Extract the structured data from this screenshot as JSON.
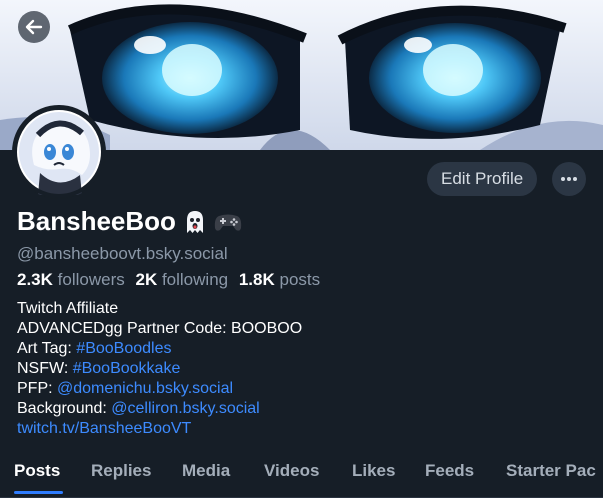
{
  "header": {
    "back_icon": "arrow-left-icon"
  },
  "profile": {
    "display_name": "BansheeBoo",
    "name_emoji": [
      "ghost-emoji",
      "gamepad-emoji"
    ],
    "handle": "@bansheeboovt.bsky.social",
    "edit_button_label": "Edit Profile",
    "more_icon": "ellipsis-icon"
  },
  "stats": {
    "followers_count": "2.3K",
    "followers_label": "followers",
    "following_count": "2K",
    "following_label": "following",
    "posts_count": "1.8K",
    "posts_label": "posts"
  },
  "bio": {
    "line1": "Twitch Affiliate",
    "line2": "ADVANCEDgg Partner Code: BOOBOO",
    "art_tag_label": "Art Tag: ",
    "art_tag_link": "#BooBoodles",
    "nsfw_label": "NSFW: ",
    "nsfw_link": "#BooBookkake",
    "pfp_label": "PFP: ",
    "pfp_link": "@domenichu.bsky.social",
    "background_label": "Background: ",
    "background_link": "@celliron.bsky.social",
    "twitch_link": "twitch.tv/BansheeBooVT"
  },
  "tabs": [
    "Posts",
    "Replies",
    "Media",
    "Videos",
    "Likes",
    "Feeds",
    "Starter Pac"
  ],
  "active_tab": "Posts",
  "colors": {
    "background": "#161e27",
    "link": "#3d8bff",
    "button": "#2b3644",
    "accent": "#2f7dff"
  }
}
